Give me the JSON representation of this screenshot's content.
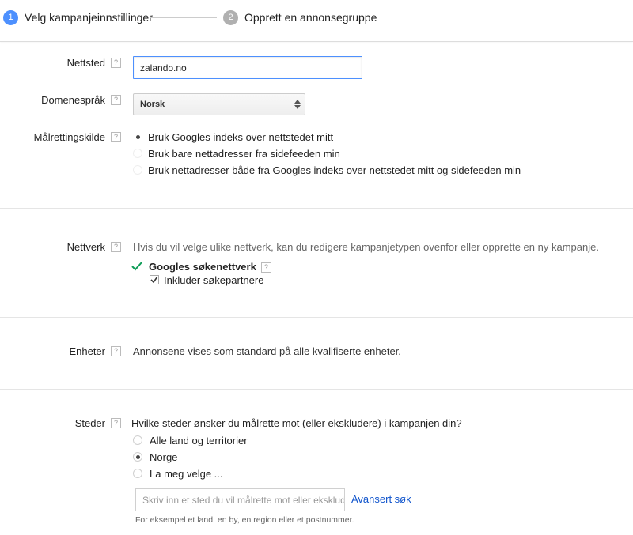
{
  "stepper": {
    "steps": [
      {
        "number": "1",
        "label": "Velg kampanjeinnstillinger",
        "state": "active"
      },
      {
        "number": "2",
        "label": "Opprett en annonsegruppe",
        "state": "inactive"
      }
    ]
  },
  "help_glyph": "?",
  "website": {
    "label": "Nettsted",
    "value": "zalando.no"
  },
  "domain_language": {
    "label": "Domenespråk",
    "selected": "Norsk"
  },
  "targeting_source": {
    "label": "Målrettingskilde",
    "options": [
      {
        "label": "Bruk Googles indeks over nettstedet mitt",
        "checked": true
      },
      {
        "label": "Bruk bare nettadresser fra sidefeeden min",
        "checked": false
      },
      {
        "label": "Bruk nettadresser både fra Googles indeks over nettstedet mitt og sidefeeden min",
        "checked": false
      }
    ]
  },
  "network": {
    "label": "Nettverk",
    "description": "Hvis du vil velge ulike nettverk, kan du redigere kampanjetypen ovenfor eller opprette en ny kampanje.",
    "search_network": "Googles søkenettverk",
    "include_partners": "Inkluder søkepartnere",
    "include_partners_checked": true
  },
  "devices": {
    "label": "Enheter",
    "description": "Annonsene vises som standard på alle kvalifiserte enheter."
  },
  "locations": {
    "label": "Steder",
    "question": "Hvilke steder ønsker du målrette mot (eller ekskludere) i kampanjen din?",
    "options": [
      {
        "label": "Alle land og territorier",
        "checked": false
      },
      {
        "label": "Norge",
        "checked": true
      },
      {
        "label": "La meg velge ...",
        "checked": false
      }
    ],
    "search_placeholder": "Skriv inn et sted du vil målrette mot eller ekskludere",
    "advanced_search": "Avansert søk",
    "hint": "For eksempel et land, en by, en region eller et postnummer."
  },
  "colors": {
    "accent": "#4d90fe",
    "check_green": "#0f9d58",
    "link": "#1155cc"
  }
}
